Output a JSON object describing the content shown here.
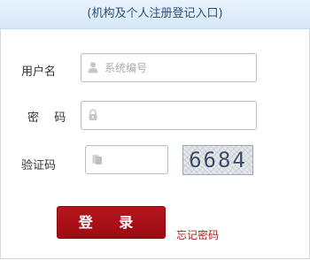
{
  "header": {
    "title": "(机构及个人注册登记入口)"
  },
  "form": {
    "username": {
      "label": "用户名",
      "placeholder": "系统编号",
      "value": ""
    },
    "password": {
      "label": "密  码",
      "value": ""
    },
    "captcha": {
      "label": "验证码",
      "value": "",
      "image_text": "6684"
    }
  },
  "actions": {
    "login_label": "登 录",
    "forgot_label": "忘记密码"
  },
  "colors": {
    "header_bg": "#dce9f7",
    "header_text": "#2c4f7a",
    "login_button": "#a80f16",
    "forgot_link": "#b01c1c"
  },
  "icons": {
    "username": "user-icon",
    "password": "lock-icon",
    "captcha": "captcha-field-icon"
  }
}
